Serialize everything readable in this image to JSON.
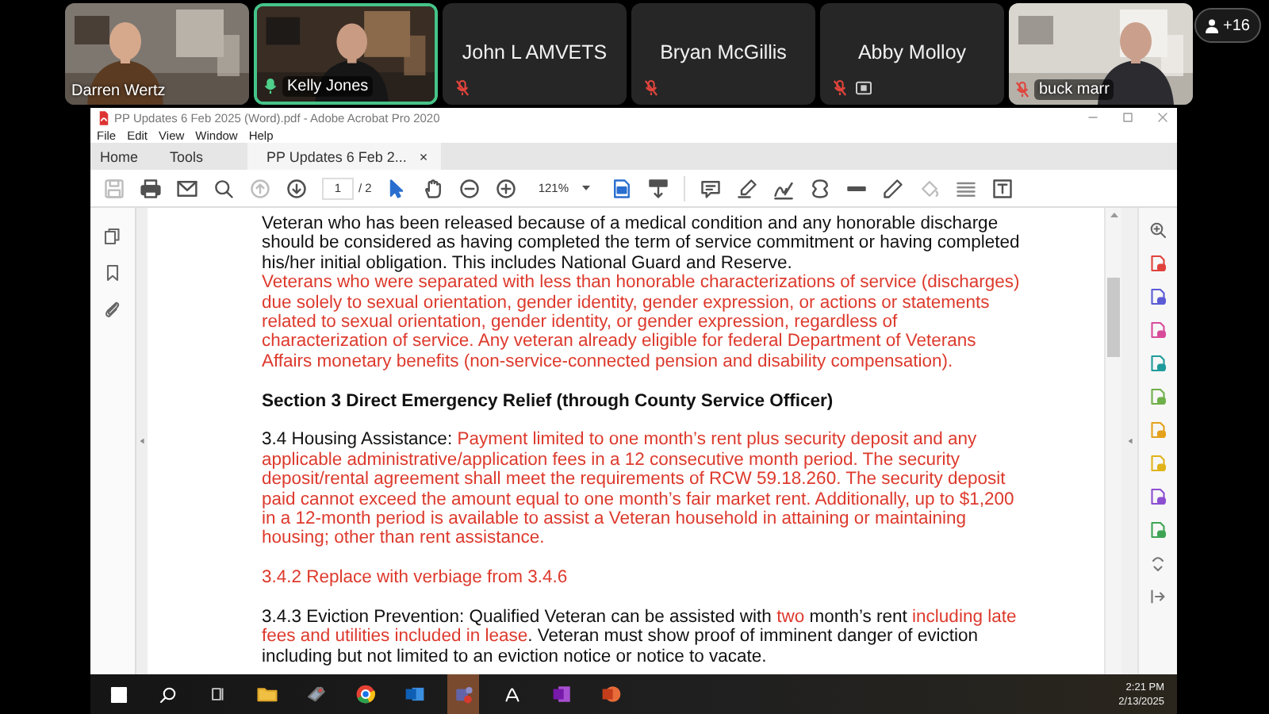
{
  "meeting": {
    "participants": [
      {
        "name": "Darren Wertz",
        "kind": "video",
        "muted": false,
        "speaking": false,
        "sharing": false
      },
      {
        "name": "Kelly Jones",
        "kind": "video",
        "muted": false,
        "speaking": true,
        "sharing": false
      },
      {
        "name": "John L AMVETS",
        "kind": "avatar",
        "muted": true,
        "speaking": false,
        "sharing": false
      },
      {
        "name": "Bryan McGillis",
        "kind": "avatar",
        "muted": true,
        "speaking": false,
        "sharing": false
      },
      {
        "name": "Abby Molloy",
        "kind": "avatar",
        "muted": true,
        "speaking": false,
        "sharing": true
      },
      {
        "name": "buck marr",
        "kind": "video",
        "muted": true,
        "speaking": false,
        "sharing": false
      }
    ],
    "more_participants": "+16"
  },
  "acrobat": {
    "title": "PP Updates 6 Feb 2025 (Word).pdf - Adobe Acrobat Pro 2020",
    "menu": [
      "File",
      "Edit",
      "View",
      "Window",
      "Help"
    ],
    "tabs": [
      {
        "label": "Home",
        "selected": false,
        "closable": false
      },
      {
        "label": "Tools",
        "selected": false,
        "closable": false
      },
      {
        "label": "PP Updates 6 Feb 2...",
        "selected": true,
        "closable": true,
        "close": "×"
      }
    ],
    "toolbar": {
      "page": "1",
      "page_total": "/ 2",
      "zoom": "121%"
    },
    "document": {
      "blocks": [
        [
          {
            "kind": "body",
            "runs": [
              {
                "text": "Veteran who has been released because of a medical condition and any honorable discharge should be considered as having completed the term of service commitment or having completed his/her initial obligation. This includes National Guard and Reserve.",
                "revised": false
              }
            ]
          },
          {
            "kind": "body",
            "runs": [
              {
                "text": "Veterans who were separated with less than honorable characterizations of service (discharges) due solely to sexual orientation, gender identity, gender expression, or actions or statements related to sexual orientation, gender identity, or gender expression, regardless of characterization of service. Any veteran already eligible for federal Department of Veterans Affairs monetary benefits (non-service-connected pension and disability compensation).",
                "revised": true
              }
            ]
          }
        ],
        [
          {
            "kind": "heading",
            "runs": [
              {
                "text": "Section 3 Direct Emergency Relief (through County Service Officer)",
                "revised": false
              }
            ]
          }
        ],
        [
          {
            "kind": "body",
            "runs": [
              {
                "text": "3.4 Housing Assistance: ",
                "revised": false
              },
              {
                "text": "Payment limited to one month’s rent plus security deposit and any applicable administrative/application fees in a 12 consecutive month period. The security deposit/rental agreement shall meet the requirements of RCW 59.18.260. The security deposit paid cannot exceed the amount equal to one month’s fair market rent. Additionally, up to $1,200 in a 12-month period is available to assist a Veteran household in attaining or maintaining housing; other than rent assistance.",
                "revised": true
              }
            ]
          }
        ],
        [
          {
            "kind": "body",
            "runs": [
              {
                "text": "3.4.2 Replace with verbiage from 3.4.6",
                "revised": true
              }
            ]
          }
        ],
        [
          {
            "kind": "body",
            "runs": [
              {
                "text": "3.4.3 Eviction Prevention: Qualified Veteran can be assisted with ",
                "revised": false
              },
              {
                "text": "two",
                "revised": true
              },
              {
                "text": " month’s rent ",
                "revised": false
              },
              {
                "text": "including late fees and utilities included in lease",
                "revised": true
              },
              {
                "text": ". Veteran must show proof of imminent danger of eviction including but not limited to an eviction notice or notice to vacate.",
                "revised": false
              }
            ]
          }
        ]
      ]
    }
  },
  "taskbar": {
    "time": "2:21 PM",
    "date": "2/13/2025"
  }
}
